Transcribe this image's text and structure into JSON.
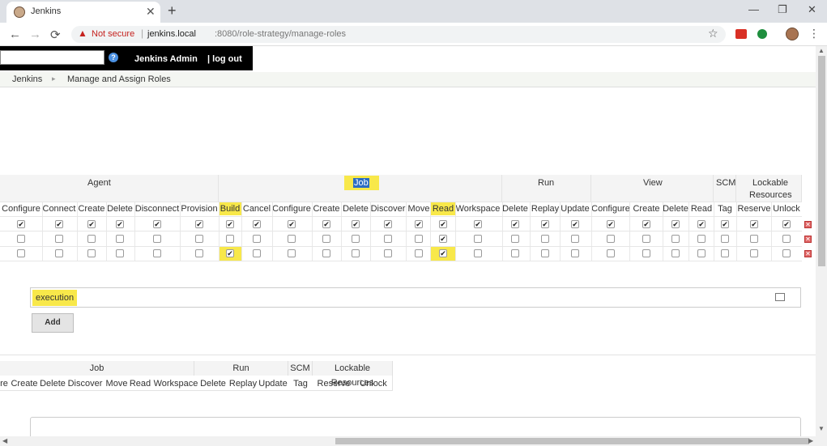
{
  "browser": {
    "tab_title": "Jenkins",
    "tab_close": "✕",
    "new_tab": "+",
    "window_min": "—",
    "window_restore": "❐",
    "window_close": "✕",
    "nav_back": "←",
    "nav_forward": "→",
    "nav_reload": "⟳",
    "warning_icon": "▲",
    "not_secure": "Not secure",
    "url_sep": "|",
    "url_host": "jenkins.local",
    "url_path": ":8080/role-strategy/manage-roles",
    "star": "☆",
    "menu": "⋮"
  },
  "header": {
    "help": "?",
    "user": "Jenkins Admin",
    "logout": "| log out"
  },
  "breadcrumb": {
    "root": "Jenkins",
    "sep": "▸",
    "page": "Manage and Assign Roles"
  },
  "roles_table": {
    "groups": [
      "Agent",
      "Job",
      "Run",
      "View",
      "SCM",
      "Lockable",
      "Resources"
    ],
    "columns": [
      "Configure",
      "Connect",
      "Create",
      "Delete",
      "Disconnect",
      "Provision",
      "Build",
      "Cancel",
      "Configure",
      "Create",
      "Delete",
      "Discover",
      "Move",
      "Read",
      "Workspace",
      "Delete",
      "Replay",
      "Update",
      "Configure",
      "Create",
      "Delete",
      "Read",
      "Tag",
      "Reserve",
      "Unlock"
    ],
    "check_mark": "✔",
    "delete_mark": "✕",
    "rows": [
      [
        1,
        1,
        1,
        1,
        1,
        1,
        1,
        1,
        1,
        1,
        1,
        1,
        1,
        1,
        1,
        1,
        1,
        1,
        1,
        1,
        1,
        1,
        1,
        1,
        1
      ],
      [
        0,
        0,
        0,
        0,
        0,
        0,
        0,
        0,
        0,
        0,
        0,
        0,
        0,
        1,
        0,
        0,
        0,
        0,
        0,
        0,
        0,
        0,
        0,
        0,
        0
      ],
      [
        0,
        0,
        0,
        0,
        0,
        0,
        1,
        0,
        0,
        0,
        0,
        0,
        0,
        1,
        0,
        0,
        0,
        0,
        0,
        0,
        0,
        0,
        0,
        0,
        0
      ]
    ]
  },
  "add_role": {
    "value": "execution",
    "button": "Add"
  },
  "second_table": {
    "groups": [
      "Job",
      "Run",
      "SCM",
      "Lockable Resources"
    ],
    "columns": [
      "re",
      "Create",
      "Delete",
      "Discover",
      "Move",
      "Read",
      "Workspace",
      "Delete",
      "Replay",
      "Update",
      "Tag",
      "Reserve",
      "Unlock"
    ]
  },
  "scroll": {
    "up": "▲",
    "down": "▼",
    "left": "◀",
    "right": "▶"
  },
  "colors": {
    "highlight": "#f8e84a",
    "header_bg": "#000000"
  }
}
